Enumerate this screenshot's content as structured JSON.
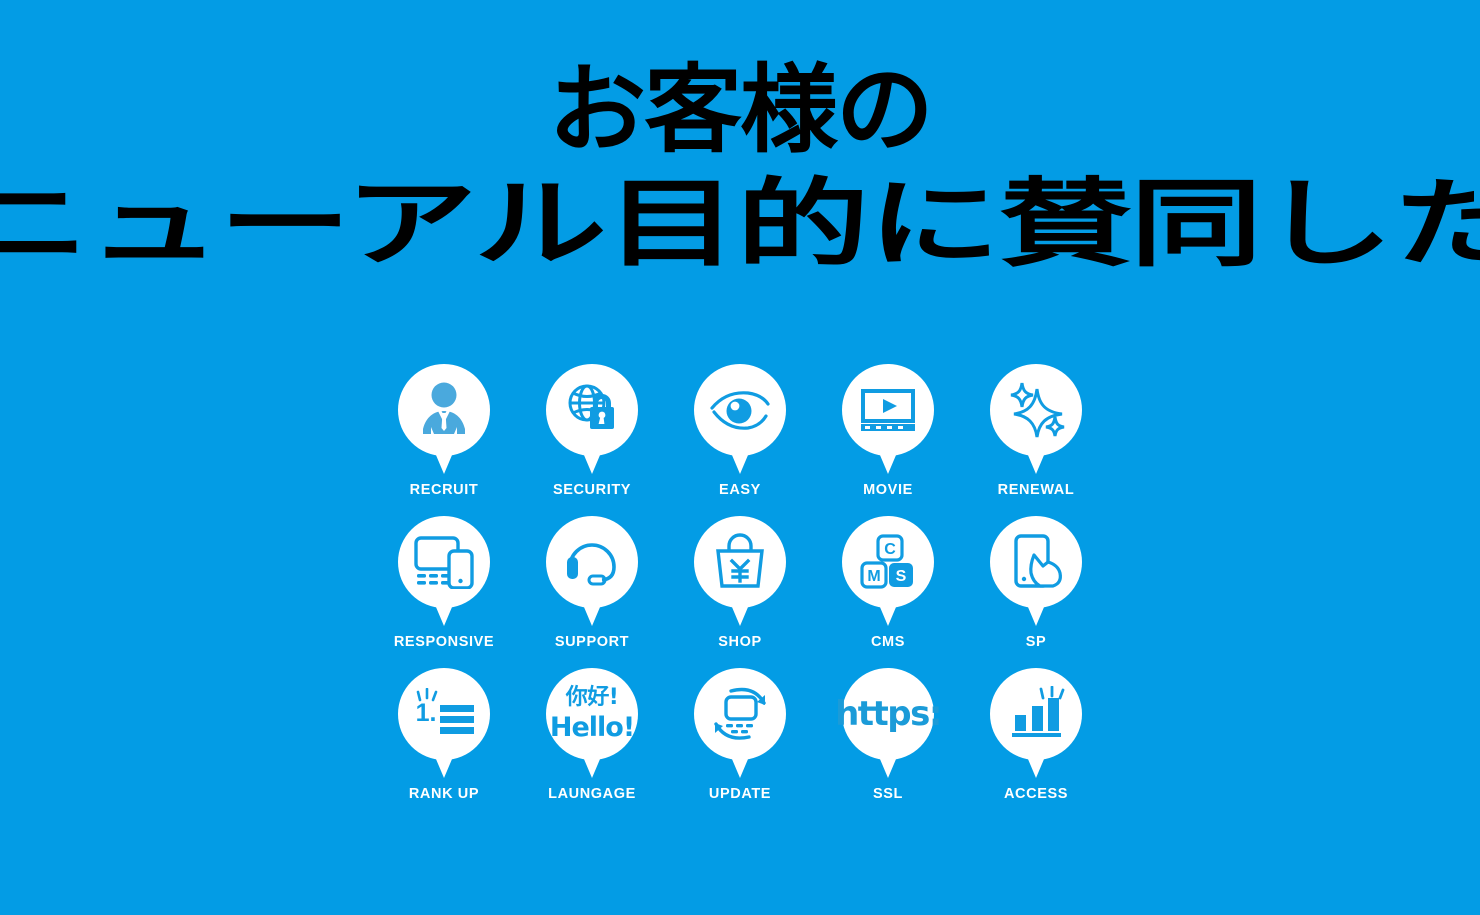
{
  "page": {
    "background_color": "#039ce5",
    "title_color": "#000000",
    "icon_blue": "#109ce2",
    "icon_blue_soft": "#4aa9dd",
    "label_color": "#ffffff"
  },
  "title": {
    "line1": "お客様の",
    "line2": "リニューアル目的に賛同した話"
  },
  "icon_grid": {
    "rows": [
      {
        "cells": [
          {
            "label": "RECRUIT",
            "icon": "businessman-icon"
          },
          {
            "label": "SECURITY",
            "icon": "globe-padlock-icon"
          },
          {
            "label": "EASY",
            "icon": "eye-icon"
          },
          {
            "label": "MOVIE",
            "icon": "video-player-icon"
          },
          {
            "label": "RENEWAL",
            "icon": "sparkle-icon"
          }
        ]
      },
      {
        "cells": [
          {
            "label": "RESPONSIVE",
            "icon": "laptop-smartphone-icon"
          },
          {
            "label": "SUPPORT",
            "icon": "headset-icon"
          },
          {
            "label": "SHOP",
            "icon": "shopping-bag-yen-icon"
          },
          {
            "label": "CMS",
            "icon": "cms-blocks-icon"
          },
          {
            "label": "SP",
            "icon": "smartphone-tap-icon"
          }
        ]
      },
      {
        "cells": [
          {
            "label": "RANK UP",
            "icon": "rank-one-list-icon"
          },
          {
            "label": "LAUNGAGE",
            "icon": "language-hello-icon"
          },
          {
            "label": "UPDATE",
            "icon": "refresh-laptop-icon"
          },
          {
            "label": "SSL",
            "icon": "https-icon"
          },
          {
            "label": "ACCESS",
            "icon": "bar-chart-icon"
          }
        ]
      }
    ]
  },
  "icon_text": {
    "cms_c": "C",
    "cms_m": "M",
    "cms_s": "S",
    "shop_currency": "¥",
    "rank_number": "1.",
    "language_cn": "你好!",
    "language_en": "Hello!",
    "ssl_text": "https:"
  }
}
